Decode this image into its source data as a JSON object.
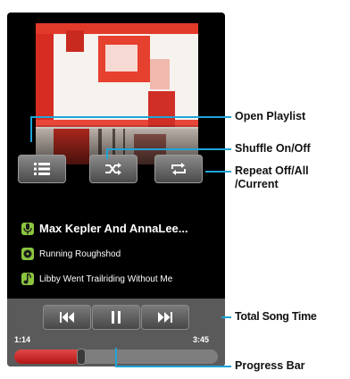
{
  "player": {
    "artist": "Max Kepler And AnnaLee...",
    "album": "Running Roughshod",
    "song": "Libby Went Trailriding Without  Me",
    "elapsed": "1:14",
    "total": "3:45",
    "progress_fraction": 0.33
  },
  "buttons": {
    "playlist_icon": "list-icon",
    "shuffle_icon": "shuffle-icon",
    "repeat_icon": "repeat-icon",
    "prev_icon": "previous-icon",
    "pause_icon": "pause-icon",
    "next_icon": "next-icon"
  },
  "callouts": {
    "open_playlist": "Open Playlist",
    "shuffle": "Shuffle On/Off",
    "repeat_line1": "Repeat Off/All",
    "repeat_line2": "/Current",
    "total_time": "Total Song Time",
    "progress_bar": "Progress Bar"
  },
  "colors": {
    "accent": "#1ea4d8",
    "icon_bg": "#8bc53f",
    "progress": "#c82222"
  }
}
